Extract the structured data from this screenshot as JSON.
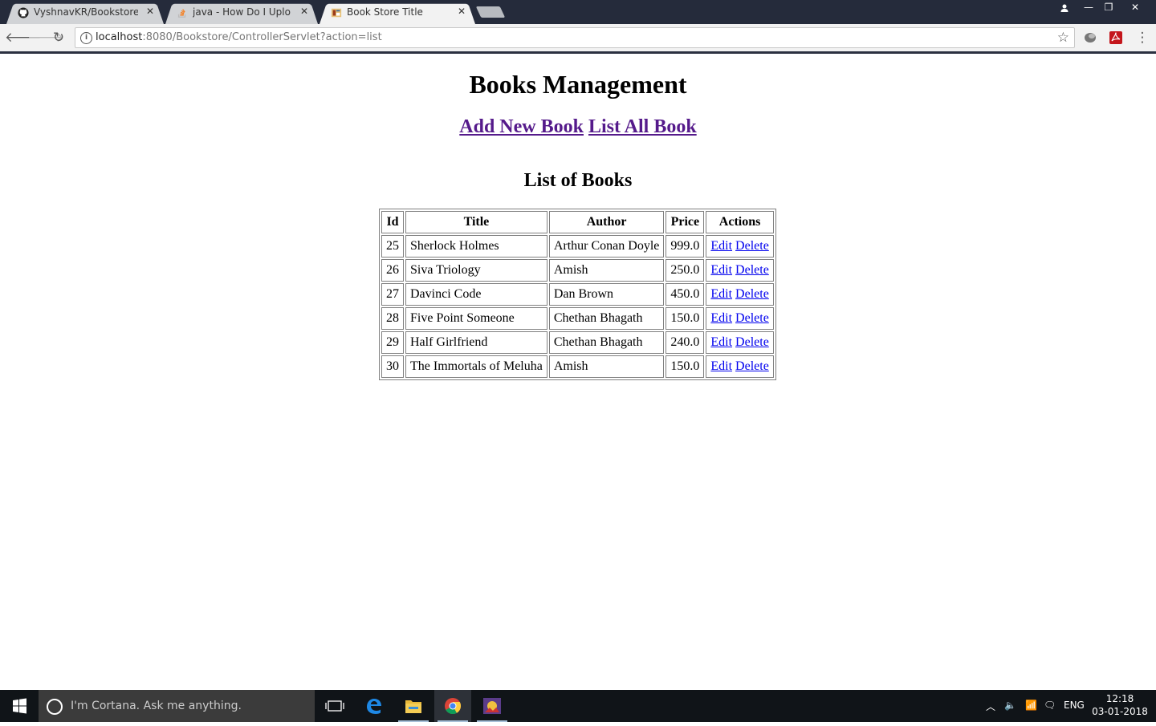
{
  "browser": {
    "tabs": [
      {
        "title": "VyshnavKR/Bookstore: A",
        "icon": "github-icon",
        "active": false
      },
      {
        "title": "java - How Do I Upload E",
        "icon": "stackoverflow-icon",
        "active": false
      },
      {
        "title": "Book Store Title",
        "icon": "page-icon",
        "active": true
      }
    ],
    "url_host": "localhost",
    "url_rest": ":8080/Bookstore/ControllerServlet?action=list"
  },
  "page": {
    "title": "Books Management",
    "links": {
      "add_new": "Add New Book",
      "list_all": "List All Book"
    },
    "list_title": "List of Books",
    "table": {
      "headers": [
        "Id",
        "Title",
        "Author",
        "Price",
        "Actions"
      ],
      "edit_label": "Edit",
      "delete_label": "Delete",
      "rows": [
        {
          "id": "25",
          "title": "Sherlock Holmes",
          "author": "Arthur Conan Doyle",
          "price": "999.0"
        },
        {
          "id": "26",
          "title": "Siva Triology",
          "author": "Amish",
          "price": "250.0"
        },
        {
          "id": "27",
          "title": "Davinci Code",
          "author": "Dan Brown",
          "price": "450.0"
        },
        {
          "id": "28",
          "title": "Five Point Someone",
          "author": "Chethan Bhagath",
          "price": "150.0"
        },
        {
          "id": "29",
          "title": "Half Girlfriend",
          "author": "Chethan Bhagath",
          "price": "240.0"
        },
        {
          "id": "30",
          "title": "The Immortals of Meluha",
          "author": "Amish",
          "price": "150.0"
        }
      ]
    }
  },
  "taskbar": {
    "cortana_placeholder": "I'm Cortana. Ask me anything.",
    "language": "ENG",
    "time": "12:18",
    "date": "03-01-2018"
  }
}
